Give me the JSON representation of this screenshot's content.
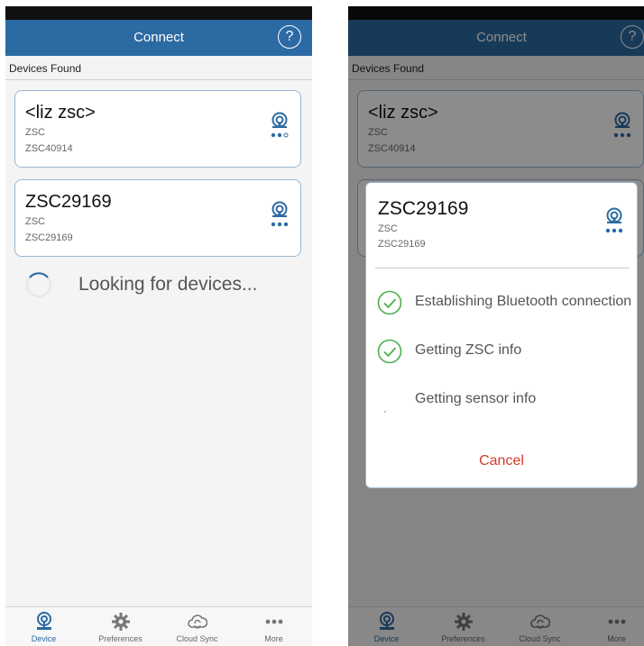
{
  "colors": {
    "accent": "#2c6aa3",
    "cancel": "#d63a2a",
    "success": "#4caf50"
  },
  "left": {
    "header": {
      "title": "Connect",
      "help_label": "?"
    },
    "section_label": "Devices Found",
    "devices": [
      {
        "name": "<liz zsc>",
        "type": "ZSC",
        "serial": "ZSC40914"
      },
      {
        "name": "ZSC29169",
        "type": "ZSC",
        "serial": "ZSC29169"
      }
    ],
    "status_text": "Looking for devices...",
    "tabs": [
      {
        "label": "Device",
        "icon": "device-icon"
      },
      {
        "label": "Preferences",
        "icon": "gear-icon"
      },
      {
        "label": "Cloud Sync",
        "icon": "cloud-sync-icon"
      },
      {
        "label": "More",
        "icon": "more-icon"
      }
    ]
  },
  "right": {
    "header": {
      "title": "Connect",
      "help_label": "?"
    },
    "section_label": "Devices Found",
    "devices": [
      {
        "name": "<liz zsc>",
        "type": "ZSC",
        "serial": "ZSC40914"
      }
    ],
    "dialog": {
      "name": "ZSC29169",
      "type": "ZSC",
      "serial": "ZSC29169",
      "steps": [
        {
          "label": "Establishing Bluetooth connection",
          "done": true
        },
        {
          "label": "Getting ZSC info",
          "done": true
        },
        {
          "label": "Getting sensor info",
          "done": false
        }
      ],
      "cancel_label": "Cancel"
    },
    "tabs": [
      {
        "label": "Device",
        "icon": "device-icon"
      },
      {
        "label": "Preferences",
        "icon": "gear-icon"
      },
      {
        "label": "Cloud Sync",
        "icon": "cloud-sync-icon"
      },
      {
        "label": "More",
        "icon": "more-icon"
      }
    ]
  }
}
